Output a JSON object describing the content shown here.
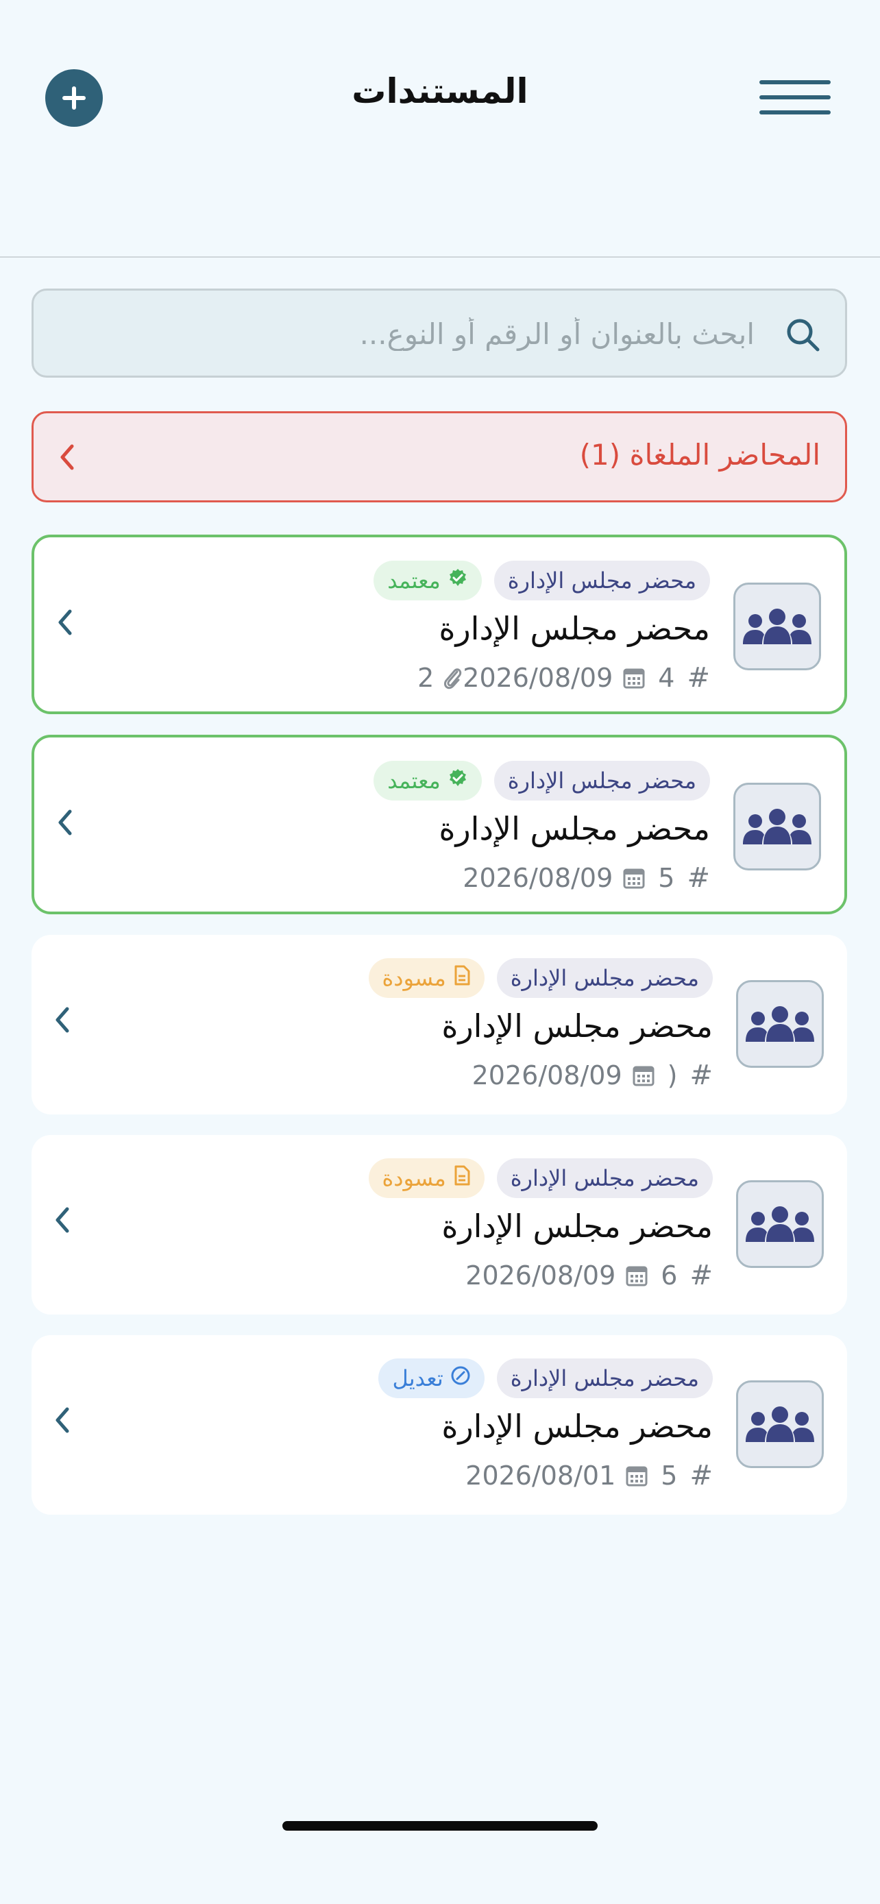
{
  "header": {
    "title": "المستندات",
    "add_icon": "plus-circle-icon",
    "menu_icon": "hamburger-menu-icon",
    "accent_color": "#2f6178"
  },
  "search": {
    "placeholder": "ابحث بالعنوان أو الرقم أو النوع...",
    "icon": "search-icon"
  },
  "cancelled_banner": {
    "label": "المحاضر الملغاة (1)",
    "color": "#d94b3e"
  },
  "documents": [
    {
      "type_label": "محضر مجلس الإدارة",
      "status_label": "معتمد",
      "status": "approved",
      "title": "محضر مجلس الإدارة",
      "hash": "#",
      "number": "4",
      "date": "2026/08/09",
      "attachments": "2"
    },
    {
      "type_label": "محضر مجلس الإدارة",
      "status_label": "معتمد",
      "status": "approved",
      "title": "محضر مجلس الإدارة",
      "hash": "#",
      "number": "5",
      "date": "2026/08/09",
      "attachments": ""
    },
    {
      "type_label": "محضر مجلس الإدارة",
      "status_label": "مسودة",
      "status": "draft",
      "title": "محضر مجلس الإدارة",
      "hash": "#",
      "number": ")",
      "date": "2026/08/09",
      "attachments": ""
    },
    {
      "type_label": "محضر مجلس الإدارة",
      "status_label": "مسودة",
      "status": "draft",
      "title": "محضر مجلس الإدارة",
      "hash": "#",
      "number": "6",
      "date": "2026/08/09",
      "attachments": ""
    },
    {
      "type_label": "محضر مجلس الإدارة",
      "status_label": "تعديل",
      "status": "modified",
      "title": "محضر مجلس الإدارة",
      "hash": "#",
      "number": "5",
      "date": "2026/08/01",
      "attachments": ""
    }
  ],
  "colors": {
    "approved": "#6cc26a",
    "draft": "#eba33a",
    "modified": "#3a7fd8",
    "group_icon": "#3c4583"
  }
}
